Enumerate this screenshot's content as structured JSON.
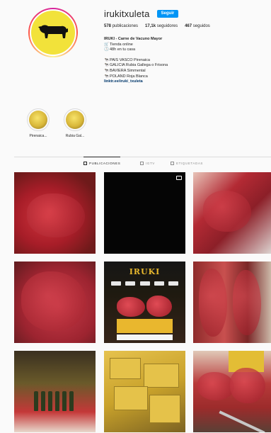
{
  "profile": {
    "username": "irukitxuleta",
    "follow_label": "Seguir",
    "stats": [
      {
        "count": "578",
        "label": "publicaciones"
      },
      {
        "count": "17,1k",
        "label": "seguidores"
      },
      {
        "count": "467",
        "label": "seguidos"
      }
    ],
    "bio": {
      "name": "IRUKI - Carne de Vacuno Mayor",
      "line1": "Tienda online",
      "line2": "48h en tu casa",
      "origins": [
        "PAIS VASCO Pirenaica",
        "GALICIA Rubia Gallega o Frisona",
        "BAVIERA Simmental",
        "POLAND Roja Blanca"
      ],
      "link": "linktr.ee/iruki_txuleta"
    }
  },
  "highlights": [
    {
      "label": "Pirenaica..."
    },
    {
      "label": "Rubia Gal..."
    }
  ],
  "tabs": [
    {
      "label": "PUBLICACIONES",
      "active": true
    },
    {
      "label": "IGTV",
      "active": false
    },
    {
      "label": "ETIQUETADAS",
      "active": false
    }
  ],
  "posts": {
    "poster_title": "IRUKI"
  },
  "colors": {
    "accent_blue": "#0095f6",
    "link": "#00376b",
    "brand_yellow": "#f2e23a"
  }
}
